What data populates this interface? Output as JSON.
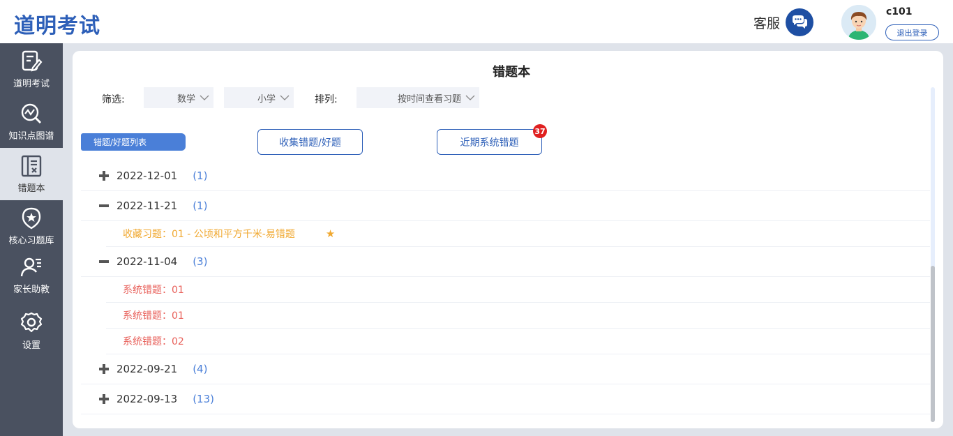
{
  "app": {
    "title": "道明考试"
  },
  "header": {
    "service_label": "客服",
    "username": "c101",
    "logout_label": "退出登录"
  },
  "sidebar": {
    "items": [
      {
        "label": "道明考试",
        "icon": "exam-edit-icon",
        "active": false
      },
      {
        "label": "知识点图谱",
        "icon": "knowledge-graph-icon",
        "active": false
      },
      {
        "label": "错题本",
        "icon": "error-book-icon",
        "active": true
      },
      {
        "label": "核心习题库",
        "icon": "star-badge-icon",
        "active": false
      },
      {
        "label": "家长助教",
        "icon": "parent-user-icon",
        "active": false
      },
      {
        "label": "设置",
        "icon": "gear-icon",
        "active": false
      }
    ]
  },
  "page": {
    "title": "错题本",
    "filter_label": "筛选:",
    "filter_subject": "数学",
    "filter_level": "小学",
    "sort_label": "排列:",
    "sort_value": "按时间查看习题",
    "tab_label": "错题/好题列表",
    "collect_button": "收集错题/好题",
    "recent_button": "近期系统错题",
    "recent_badge": "37"
  },
  "groups": [
    {
      "date": "2022-12-01",
      "count": "(1)",
      "expanded": false,
      "items": []
    },
    {
      "date": "2022-11-21",
      "count": "(1)",
      "expanded": true,
      "items": [
        {
          "text": "收藏习题：01 - 公顷和平方千米-易错题",
          "type": "favorite",
          "star": "★"
        }
      ]
    },
    {
      "date": "2022-11-04",
      "count": "(3)",
      "expanded": true,
      "items": [
        {
          "text": "系统错题：01",
          "type": "error"
        },
        {
          "text": "系统错题：01",
          "type": "error"
        },
        {
          "text": "系统错题：02",
          "type": "error"
        }
      ]
    },
    {
      "date": "2022-09-21",
      "count": "(4)",
      "expanded": false,
      "items": []
    },
    {
      "date": "2022-09-13",
      "count": "(13)",
      "expanded": false,
      "items": []
    }
  ],
  "colors": {
    "primary": "#2d5fb8",
    "sidebar": "#4a5160",
    "favorite": "#f0a830",
    "error": "#e8605a",
    "badge": "#e02020"
  }
}
